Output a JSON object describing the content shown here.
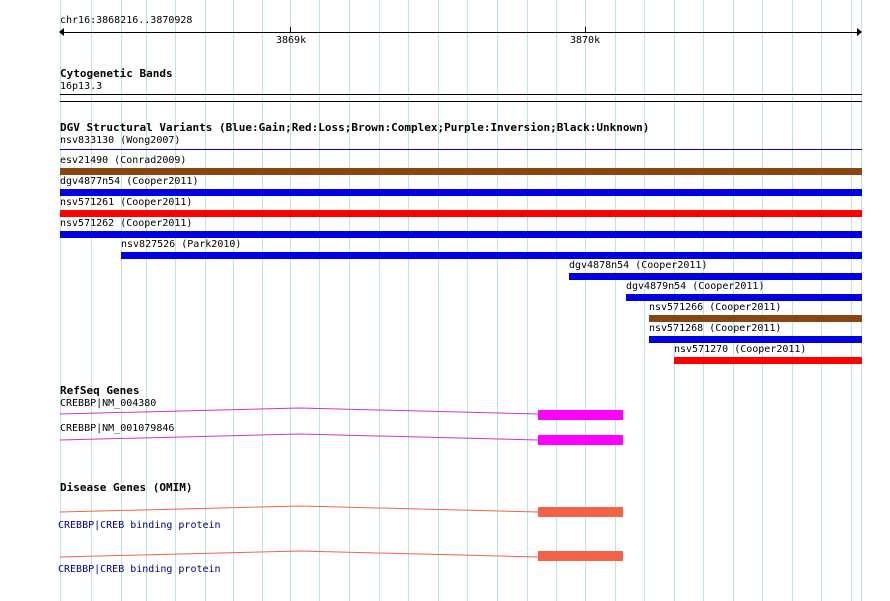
{
  "ruler": {
    "locus": "chr16:3868216..3870928",
    "tick_labels": [
      "3869k",
      "3870k"
    ]
  },
  "cytoband": {
    "title": "Cytogenetic Bands",
    "band": "16p13.3"
  },
  "dgv": {
    "title": "DGV Structural Variants (Blue:Gain;Red:Loss;Brown:Complex;Purple:Inversion;Black:Unknown)",
    "variants": [
      {
        "label": "nsv833130 (Wong2007)",
        "color": "#0000cc",
        "kind": "thin"
      },
      {
        "label": "esv21490 (Conrad2009)",
        "color": "#8b4513",
        "kind": "bar"
      },
      {
        "label": "dgv4877n54 (Cooper2011)",
        "color": "#0000e0",
        "kind": "bar"
      },
      {
        "label": "nsv571261 (Cooper2011)",
        "color": "#ff0000",
        "kind": "bar"
      },
      {
        "label": "nsv571262 (Cooper2011)",
        "color": "#0000e0",
        "kind": "bar"
      },
      {
        "label": "nsv827526 (Park2010)",
        "color": "#0000e0",
        "kind": "bar"
      },
      {
        "label": "dgv4878n54 (Cooper2011)",
        "color": "#0000e0",
        "kind": "bar"
      },
      {
        "label": "dgv4879n54 (Cooper2011)",
        "color": "#0000e0",
        "kind": "bar"
      },
      {
        "label": "nsv571266 (Cooper2011)",
        "color": "#8b4513",
        "kind": "bar"
      },
      {
        "label": "nsv571268 (Cooper2011)",
        "color": "#0000e0",
        "kind": "bar"
      },
      {
        "label": "nsv571270 (Cooper2011)",
        "color": "#ff0000",
        "kind": "bar"
      }
    ]
  },
  "refseq": {
    "title": "RefSeq Genes",
    "color": "#ff00ff",
    "line_color": "#cc33cc",
    "genes": [
      "CREBBP|NM_004380",
      "CREBBP|NM_001079846"
    ]
  },
  "omim": {
    "title": "Disease Genes (OMIM)",
    "color": "#f26249",
    "genes": [
      "CREBBP|CREB binding protein",
      "CREBBP|CREB binding protein"
    ],
    "label_color": "#000080"
  },
  "colors": {
    "grid": "#bfe3ee"
  }
}
